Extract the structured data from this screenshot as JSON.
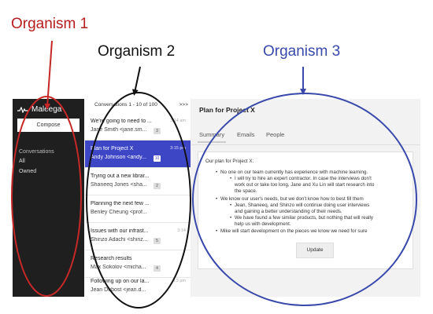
{
  "labels": {
    "organism1": "Organism 1",
    "organism2": "Organism 2",
    "organism3": "Organism 3"
  },
  "colors": {
    "organism1": "#c62828",
    "organism2": "#111111",
    "organism3": "#3949ab",
    "sidebar_bg": "#1f1f1f",
    "selected_row": "#3d47c6"
  },
  "sidebar": {
    "brand": "Maleega",
    "compose": "Compose",
    "section": "Conversations",
    "items": [
      "All",
      "Owned"
    ]
  },
  "list": {
    "header": "Conversations 1 - 10 of 100",
    "next": ">>>",
    "rows": [
      {
        "subject": "We're going to need to ...",
        "from": "Jane Smith <jane.sm...",
        "time": "3:14 am",
        "count": "3"
      },
      {
        "subject": "Plan for Project X",
        "from": "Andy Johnson <andy...",
        "time": "3:15 pm",
        "count": "10"
      },
      {
        "subject": "Trying out a new librar...",
        "from": "Shaneeq Jones <sha...",
        "time": "",
        "count": "2"
      },
      {
        "subject": "Planning the next few ...",
        "from": "Benley Cheung <prof...",
        "time": "",
        "count": ""
      },
      {
        "subject": "Issues with our infrast...",
        "from": "Shinzo Adachi <shinz...",
        "time": "3:14",
        "count": "5"
      },
      {
        "subject": "Research results",
        "from": "Max Sokolov <micha...",
        "time": "",
        "count": "4"
      },
      {
        "subject": "Following up on our la...",
        "from": "Jean Dubost <jean.d...",
        "time": "3:3 pm",
        "count": ""
      }
    ]
  },
  "detail": {
    "title": "Plan for Project X",
    "tabs": [
      "Summary",
      "Emails",
      "People"
    ],
    "intro": "Our plan for Project X:",
    "b1": "No one on our team currently has experience with machine learning.",
    "b1a1": "I will try to hire an expert contractor. In case the interviews don't",
    "b1a2": "work out or take too long, Jane and Xu Lin will start research into",
    "b1a3": "the space.",
    "b2": "We know our user's needs, but we don't know how to best fill them",
    "b2a": "Jean, Shaneeq, and Shinzo will continue doing user interviews",
    "b2a2": "and gaining a better understanding of their needs.",
    "b2b": "We have found a few similar products, but nothing that will really",
    "b2b2": "help us with development.",
    "b3": "Mike will start development on the pieces we know we need for sure",
    "update": "Update"
  }
}
